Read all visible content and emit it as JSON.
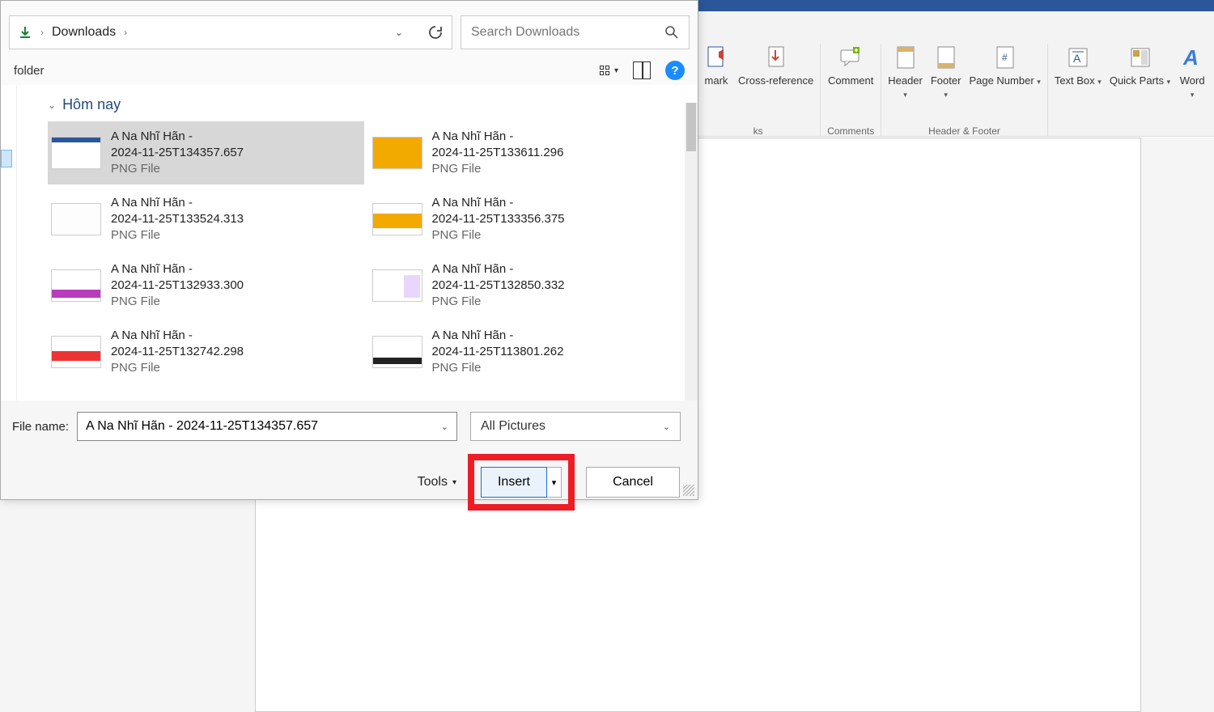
{
  "word": {
    "ribbon": {
      "groups": [
        {
          "label": "ks",
          "buttons": [
            {
              "name": "bookmark",
              "label": "mark"
            },
            {
              "name": "cross-reference",
              "label": "Cross-reference"
            }
          ]
        },
        {
          "label": "Comments",
          "buttons": [
            {
              "name": "comment",
              "label": "Comment"
            }
          ]
        },
        {
          "label": "Header & Footer",
          "buttons": [
            {
              "name": "header",
              "label": "Header"
            },
            {
              "name": "footer",
              "label": "Footer"
            },
            {
              "name": "page-number",
              "label": "Page Number"
            }
          ]
        },
        {
          "label": "",
          "buttons": [
            {
              "name": "text-box",
              "label": "Text Box"
            },
            {
              "name": "quick-parts",
              "label": "Quick Parts"
            },
            {
              "name": "wordart",
              "label": "Word"
            }
          ]
        }
      ]
    }
  },
  "dialog": {
    "breadcrumb": {
      "current": "Downloads"
    },
    "search": {
      "placeholder": "Search Downloads"
    },
    "newfolder_label": "folder",
    "help_char": "?",
    "group_label": "Hôm nay",
    "files": [
      {
        "name1": "A Na Nhĩ Hãn -",
        "name2": "2024-11-25T134357.657",
        "type": "PNG File"
      },
      {
        "name1": "A Na Nhĩ Hãn -",
        "name2": "2024-11-25T133611.296",
        "type": "PNG File"
      },
      {
        "name1": "A Na Nhĩ Hãn -",
        "name2": "2024-11-25T133524.313",
        "type": "PNG File"
      },
      {
        "name1": "A Na Nhĩ Hãn -",
        "name2": "2024-11-25T133356.375",
        "type": "PNG File"
      },
      {
        "name1": "A Na Nhĩ Hãn -",
        "name2": "2024-11-25T132933.300",
        "type": "PNG File"
      },
      {
        "name1": "A Na Nhĩ Hãn -",
        "name2": "2024-11-25T132850.332",
        "type": "PNG File"
      },
      {
        "name1": "A Na Nhĩ Hãn -",
        "name2": "2024-11-25T132742.298",
        "type": "PNG File"
      },
      {
        "name1": "A Na Nhĩ Hãn -",
        "name2": "2024-11-25T113801.262",
        "type": "PNG File"
      }
    ],
    "filename_label": "File name:",
    "filename_value": "A Na Nhĩ Hãn - 2024-11-25T134357.657",
    "filter_value": "All Pictures",
    "tools_label": "Tools",
    "insert_label": "Insert",
    "cancel_label": "Cancel"
  }
}
